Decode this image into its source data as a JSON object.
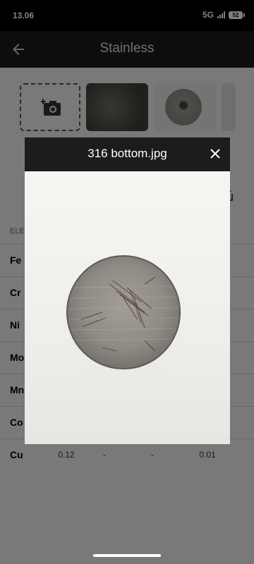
{
  "status": {
    "time": "13.06",
    "network": "5G",
    "battery": "52"
  },
  "appbar": {
    "title": "Stainless",
    "back_icon": "arrow-back-icon"
  },
  "thumbnails": {
    "add_icon": "add-photo-icon"
  },
  "table": {
    "header": "ELE",
    "rows": [
      {
        "el": "Fe",
        "v1": "",
        "v2": "",
        "v3": "",
        "v4": ""
      },
      {
        "el": "Cr",
        "v1": "",
        "v2": "",
        "v3": "",
        "v4": ""
      },
      {
        "el": "Ni",
        "v1": "",
        "v2": "",
        "v3": "",
        "v4": ""
      },
      {
        "el": "Mo",
        "v1": "",
        "v2": "",
        "v3": "",
        "v4": ""
      },
      {
        "el": "Mn",
        "v1": "",
        "v2": "",
        "v3": "",
        "v4": ""
      },
      {
        "el": "Co",
        "v1": "",
        "v2": "",
        "v3": "",
        "v4": ""
      },
      {
        "el": "Cu",
        "v1": "0.12",
        "v2": "-",
        "v3": "-",
        "v4": "0.01"
      }
    ]
  },
  "dialog": {
    "title": "316 bottom.jpg",
    "close_icon": "close-icon"
  },
  "colors": {
    "scrim": "#000000",
    "dialog_header": "#1c1c1c",
    "appbar": "#1a1a1a"
  }
}
